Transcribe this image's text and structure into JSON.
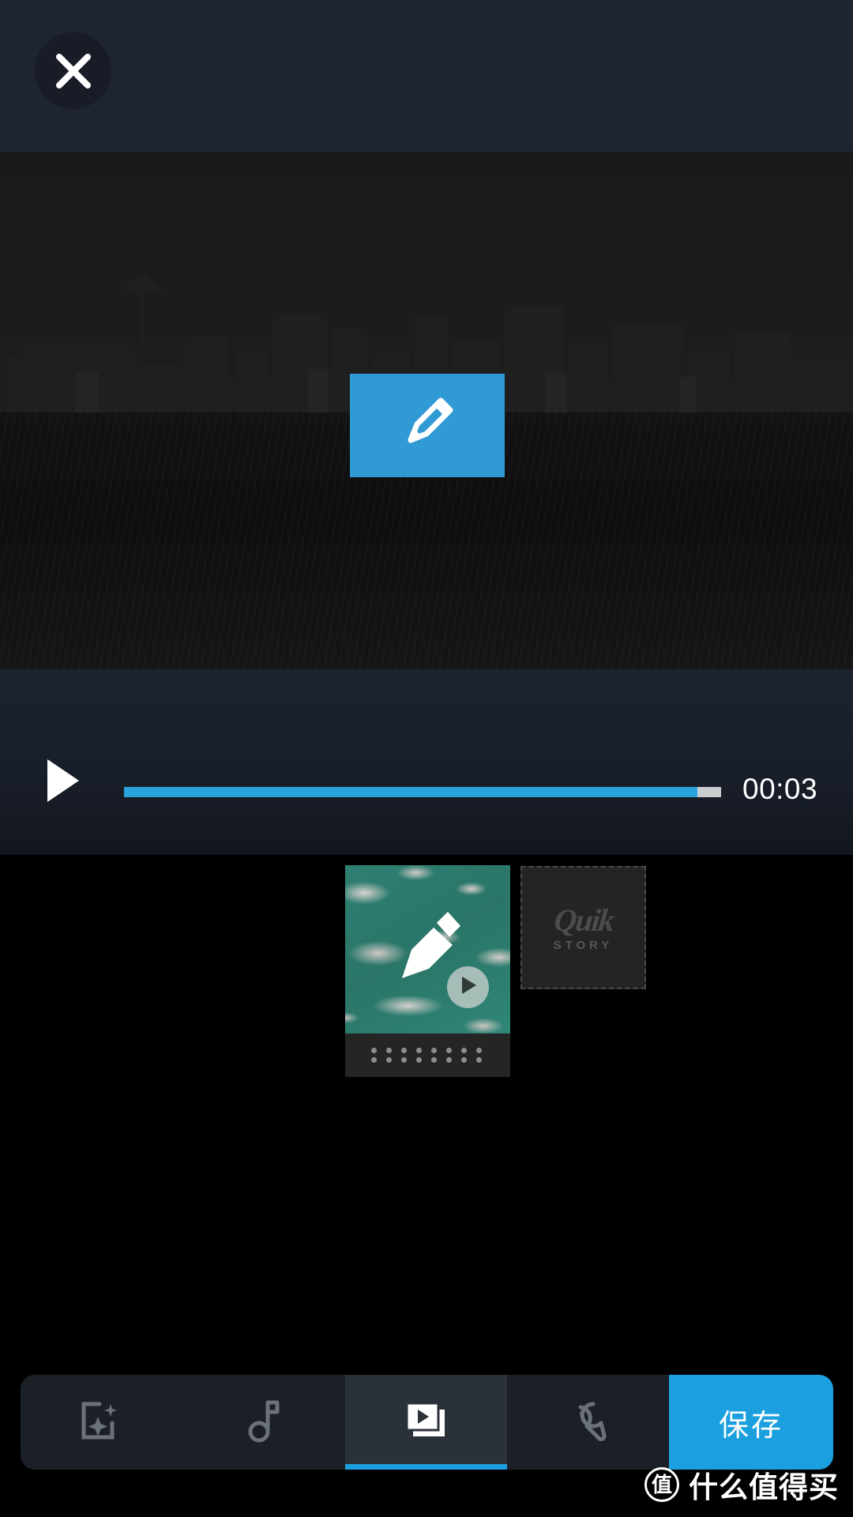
{
  "header": {
    "close_label": "×",
    "close_icon": "close-icon",
    "background_color": "#1e2431"
  },
  "preview": {
    "scene_description": "dark city skyline over water",
    "edit_overlay": {
      "icon": "pencil-icon",
      "background_color": "#2f9ad3",
      "label": ""
    }
  },
  "player": {
    "play_icon": "play-icon",
    "progress_percent": 96,
    "current_time": "00:03",
    "track_color": "#c9cdd0",
    "fill_color": "#28a3db"
  },
  "timeline": {
    "clips": [
      {
        "type": "video",
        "name": "ocean-clip",
        "overlay_icon": "pencil-icon",
        "play_icon": "play-icon",
        "handle_icon": "drag-handle-icon",
        "selected": true
      },
      {
        "type": "outro",
        "name": "quik-story-card",
        "logo_word": "Quik",
        "logo_sub": "STORY",
        "selected": false
      }
    ]
  },
  "toolbar": {
    "items": [
      {
        "name": "tab-style",
        "icon": "photo-sparkle-icon",
        "label": "",
        "active": false
      },
      {
        "name": "tab-music",
        "icon": "music-note-icon",
        "label": "",
        "active": false
      },
      {
        "name": "tab-clips",
        "icon": "video-slides-icon",
        "label": "",
        "active": true
      },
      {
        "name": "tab-settings",
        "icon": "wrench-icon",
        "label": "",
        "active": false
      }
    ],
    "save_label": "保存",
    "save_color": "#1b9fde",
    "active_underline_color": "#1b9fde"
  },
  "watermark": {
    "badge": "值",
    "text": "什么值得买"
  }
}
